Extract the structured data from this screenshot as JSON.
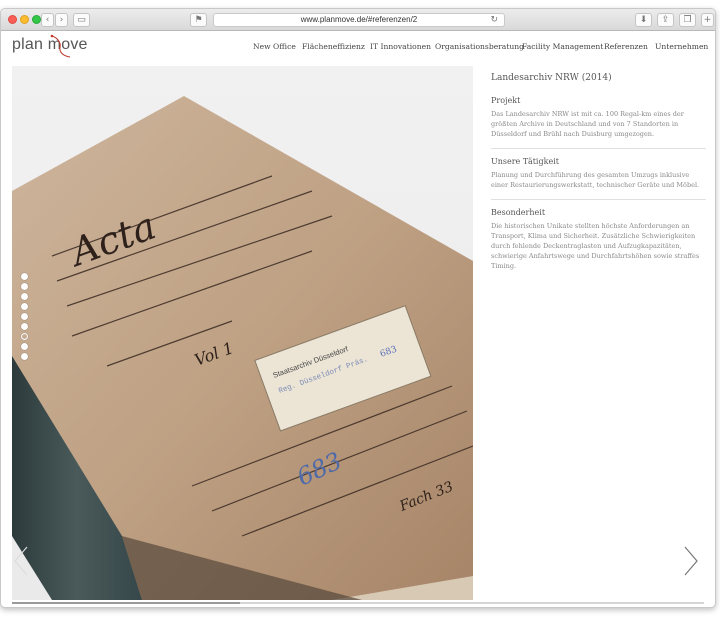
{
  "browser": {
    "url": "www.planmove.de/#referenzen/2",
    "reload_icon": "reload-icon",
    "download_icon": "download-icon",
    "share_icon": "share-icon",
    "tabs_icon": "tabs-icon",
    "add_tab": "+"
  },
  "site": {
    "logo": "plan move",
    "nav": [
      "New Office",
      "Flächeneffizienz",
      "IT Innovationen",
      "Organisationsberatung",
      "Facility Management",
      "Referenzen",
      "Unternehmen"
    ]
  },
  "slideshow": {
    "dot_count": 9,
    "active_dot": 7,
    "progress": 0.33
  },
  "project": {
    "title": "Landesarchiv NRW (2014)",
    "sections": [
      {
        "heading": "Projekt",
        "text": "Das Landesarchiv NRW ist mit ca. 100 Regal-km eines der größten Archive in Deutschland und von 7 Standorten in Düsseldorf und Brühl nach Duisburg umgezogen."
      },
      {
        "heading": "Unsere Tätigkeit",
        "text": "Planung und Durchführung des gesamten Umzugs inklusive einer Restaurierungswerkstatt, technischer Geräte und Möbel."
      },
      {
        "heading": "Besonderheit",
        "text": "Die historischen Unikate stellten höchste Anforderungen an Transport, Klima und Sicherheit. Zusätzliche Schwierigkeiten durch fehlende Deckentraglasten und Aufzugkapazitäten, schwierige Anfahrtswege und Durchfahrtshöhen sowie straffes Timing."
      }
    ]
  },
  "photo": {
    "title_text": "Acta",
    "label_line1": "Staatsarchiv Düsseldorf",
    "label_line2": "Reg. Düsseldorf Präs.",
    "label_number": "683",
    "spine_number": "683",
    "volume": "Vol 1",
    "fach": "Fach 33"
  }
}
